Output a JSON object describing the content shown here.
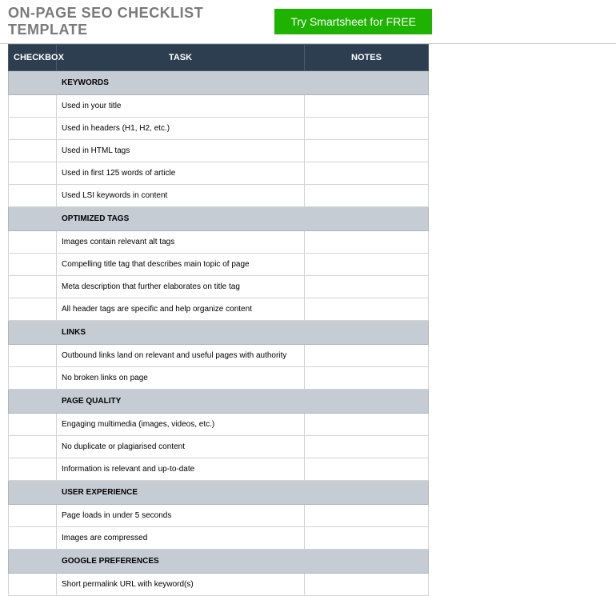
{
  "header": {
    "title": "ON-PAGE SEO CHECKLIST TEMPLATE",
    "cta": "Try Smartsheet for FREE"
  },
  "columns": {
    "checkbox": "CHECKBOX",
    "task": "TASK",
    "notes": "NOTES"
  },
  "sections": [
    {
      "name": "KEYWORDS",
      "items": [
        {
          "task": "Used in your title",
          "notes": ""
        },
        {
          "task": "Used in headers (H1, H2, etc.)",
          "notes": ""
        },
        {
          "task": "Used in HTML tags",
          "notes": ""
        },
        {
          "task": "Used in first 125 words of article",
          "notes": ""
        },
        {
          "task": "Used LSI keywords in content",
          "notes": ""
        }
      ]
    },
    {
      "name": "OPTIMIZED TAGS",
      "items": [
        {
          "task": "Images contain relevant alt tags",
          "notes": ""
        },
        {
          "task": "Compelling title tag that describes main topic of page",
          "notes": ""
        },
        {
          "task": "Meta description that further elaborates on title tag",
          "notes": ""
        },
        {
          "task": "All header tags are specific and help organize content",
          "notes": ""
        }
      ]
    },
    {
      "name": "LINKS",
      "items": [
        {
          "task": "Outbound links land on relevant and useful pages with authority",
          "notes": ""
        },
        {
          "task": "No broken links on page",
          "notes": ""
        }
      ]
    },
    {
      "name": "PAGE QUALITY",
      "items": [
        {
          "task": "Engaging multimedia (images, videos, etc.)",
          "notes": ""
        },
        {
          "task": "No duplicate or plagiarised content",
          "notes": ""
        },
        {
          "task": "Information is relevant and up-to-date",
          "notes": ""
        }
      ]
    },
    {
      "name": "USER EXPERIENCE",
      "items": [
        {
          "task": "Page loads in under 5 seconds",
          "notes": ""
        },
        {
          "task": "Images are compressed",
          "notes": ""
        }
      ]
    },
    {
      "name": "GOOGLE PREFERENCES",
      "items": [
        {
          "task": "Short permalink URL with keyword(s)",
          "notes": ""
        }
      ]
    }
  ]
}
